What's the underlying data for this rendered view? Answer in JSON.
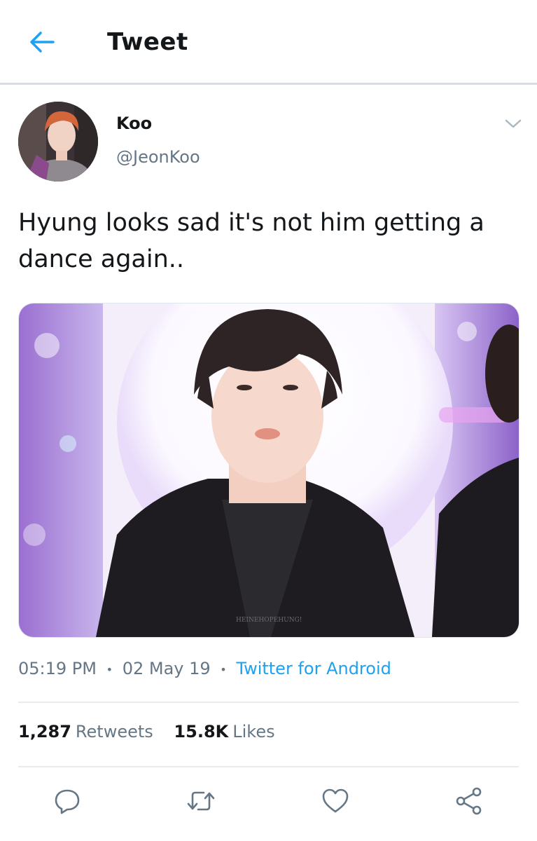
{
  "header": {
    "title": "Tweet",
    "back_icon": "arrow-left-icon"
  },
  "author": {
    "display_name": "Koo",
    "handle": "@JeonKoo"
  },
  "tweet": {
    "text": "Hyung looks sad it's not him getting a dance again..",
    "media_watermark": "HEINEHOPEHUNG!"
  },
  "meta": {
    "time": "05:19 PM",
    "date": "02 May 19",
    "separator": "•",
    "source": "Twitter for Android"
  },
  "stats": {
    "retweets_count": "1,287",
    "retweets_label": "Retweets",
    "likes_count": "15.8K",
    "likes_label": "Likes"
  },
  "actions": {
    "reply_icon": "reply-icon",
    "retweet_icon": "retweet-icon",
    "like_icon": "heart-icon",
    "share_icon": "share-icon"
  },
  "colors": {
    "accent": "#1da1f2",
    "text_primary": "#14171a",
    "text_secondary": "#657786",
    "divider": "#e6ecf0"
  }
}
